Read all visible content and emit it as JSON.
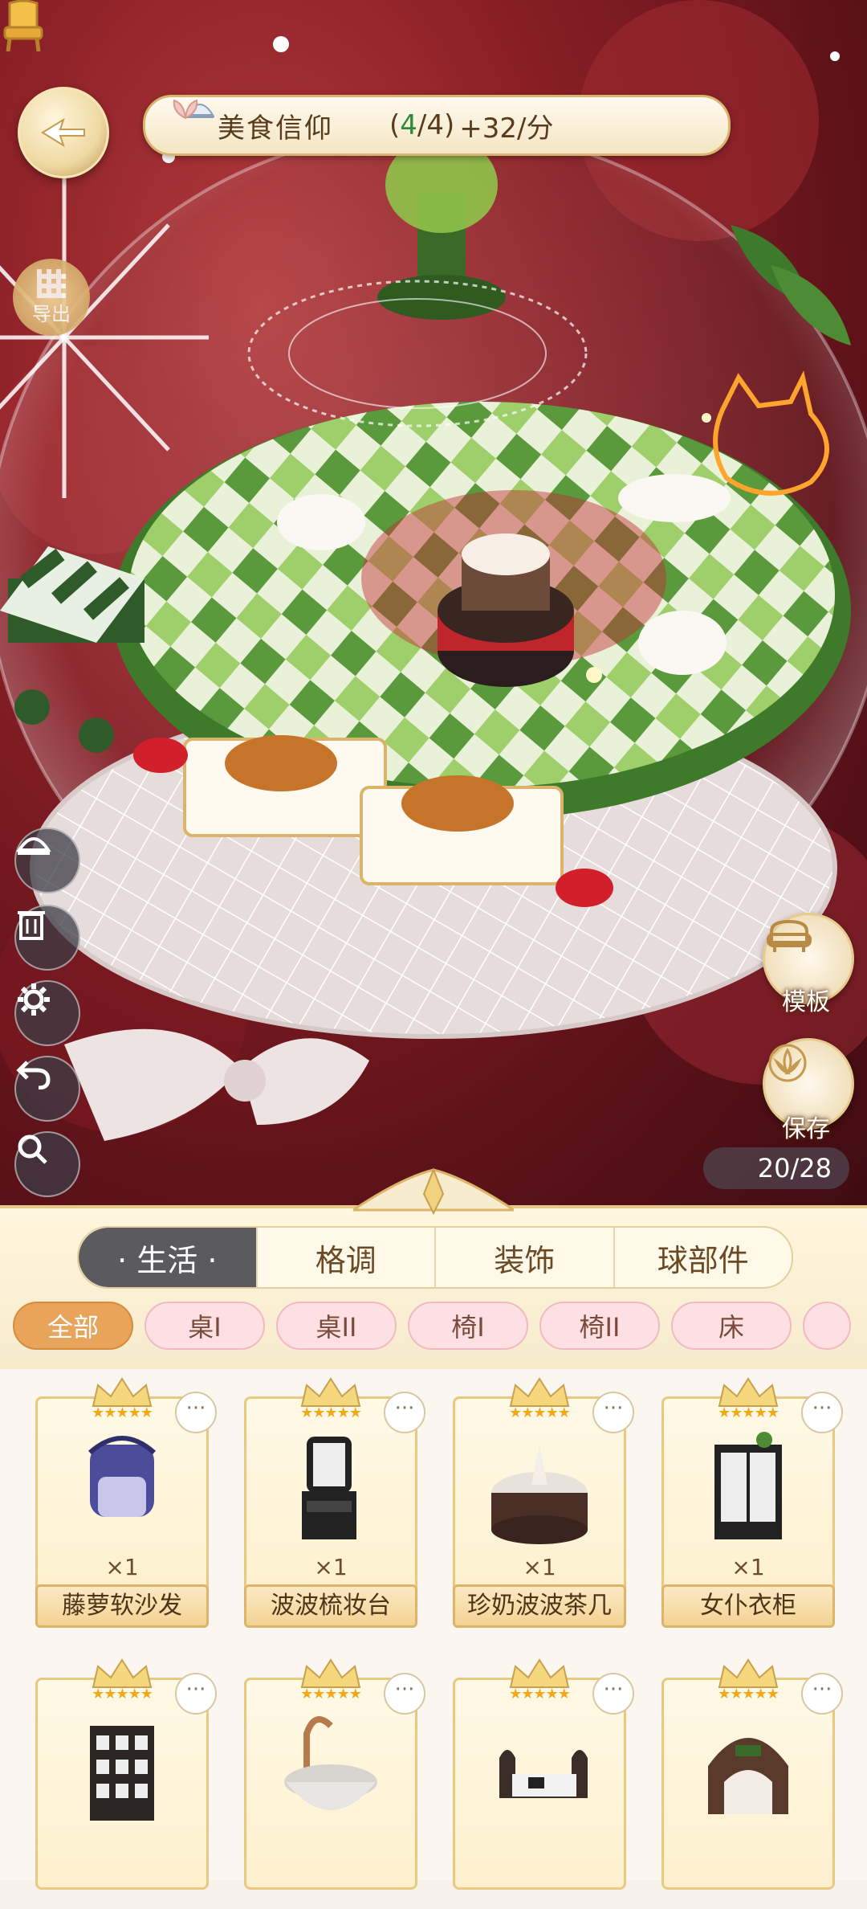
{
  "header": {
    "title": "美食信仰",
    "progress_current": "4",
    "progress_total": "4",
    "rate": "+32/分"
  },
  "side_buttons": {
    "export_label": "导出",
    "template_label": "模板",
    "save_label": "保存",
    "tools": [
      "dish-cover-icon",
      "trash-icon",
      "gear-icon",
      "undo-icon",
      "search-icon"
    ]
  },
  "capacity": "20/28",
  "main_tabs": [
    {
      "label": "· 生活 ·",
      "active": true
    },
    {
      "label": "格调",
      "active": false
    },
    {
      "label": "装饰",
      "active": false
    },
    {
      "label": "球部件",
      "active": false
    }
  ],
  "sub_tabs": [
    {
      "label": "全部",
      "active": true
    },
    {
      "label": "桌I",
      "active": false
    },
    {
      "label": "桌II",
      "active": false
    },
    {
      "label": "椅I",
      "active": false
    },
    {
      "label": "椅II",
      "active": false
    },
    {
      "label": "床",
      "active": false
    }
  ],
  "items": [
    {
      "name": "藤萝软沙发",
      "qty": "×1",
      "stars": "★★★★★"
    },
    {
      "name": "波波梳妆台",
      "qty": "×1",
      "stars": "★★★★★"
    },
    {
      "name": "珍奶波波茶几",
      "qty": "×1",
      "stars": "★★★★★"
    },
    {
      "name": "女仆衣柜",
      "qty": "×1",
      "stars": "★★★★★"
    },
    {
      "name": "",
      "qty": "",
      "stars": "★★★★★"
    },
    {
      "name": "",
      "qty": "",
      "stars": "★★★★★"
    },
    {
      "name": "",
      "qty": "",
      "stars": "★★★★★"
    },
    {
      "name": "",
      "qty": "",
      "stars": "★★★★★"
    }
  ],
  "colors": {
    "accent_gold": "#e8c97f",
    "active_tab": "#5b5b5f",
    "active_subtab": "#e8a45a",
    "subtab": "#fde0e4",
    "scene_bg": "#8a1f26"
  }
}
